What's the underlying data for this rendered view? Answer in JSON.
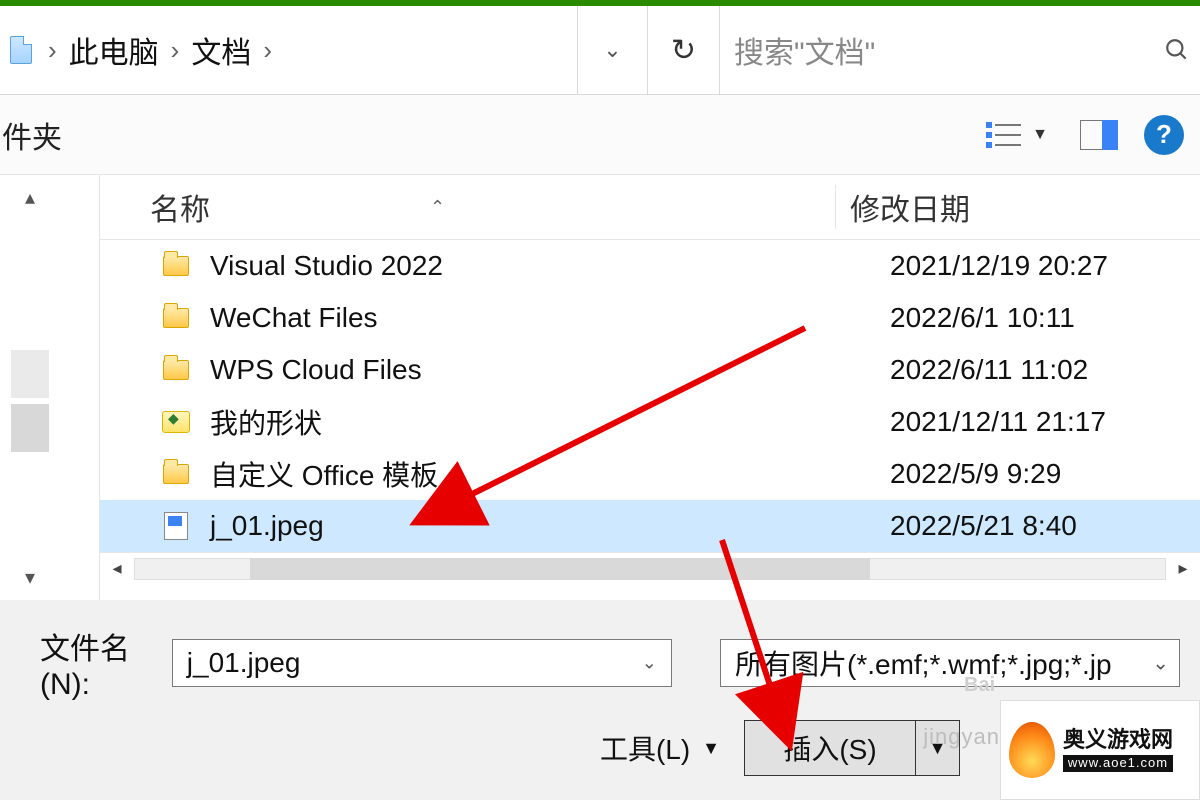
{
  "breadcrumb": {
    "loc1": "此电脑",
    "loc2": "文档"
  },
  "search": {
    "placeholder": "搜索\"文档\""
  },
  "toolbar": {
    "folder_label": "件夹"
  },
  "columns": {
    "name": "名称",
    "date": "修改日期"
  },
  "rows": [
    {
      "name": "Visual Studio 2022",
      "date": "2021/12/19 20:27",
      "icon": "folder"
    },
    {
      "name": "WeChat Files",
      "date": "2022/6/1 10:11",
      "icon": "folder"
    },
    {
      "name": "WPS Cloud Files",
      "date": "2022/6/11 11:02",
      "icon": "folder"
    },
    {
      "name": "我的形状",
      "date": "2021/12/11 21:17",
      "icon": "shape"
    },
    {
      "name": "自定义 Office 模板",
      "date": "2022/5/9 9:29",
      "icon": "folder"
    },
    {
      "name": "j_01.jpeg",
      "date": "2022/5/21 8:40",
      "icon": "image",
      "selected": true
    }
  ],
  "filename": {
    "label": "文件名(N):",
    "value": "j_01.jpeg"
  },
  "filetype": {
    "value": "所有图片(*.emf;*.wmf;*.jpg;*.jp"
  },
  "tools_label": "工具(L)",
  "insert_label": "插入(S)",
  "watermark": {
    "brand": "奥义游戏网",
    "url": "www.aoe1.com",
    "faint": "jingyan",
    "bd": "Bai"
  }
}
